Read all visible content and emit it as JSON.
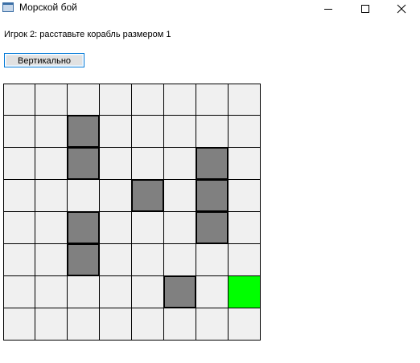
{
  "window": {
    "title": "Морской бой",
    "icon": "app-window-icon",
    "controls": {
      "minimize": "minimize-icon",
      "maximize": "maximize-icon",
      "close": "close-icon"
    }
  },
  "status": {
    "prompt": "Игрок 2: расставьте корабль размером 1"
  },
  "toolbar": {
    "orientation_label": "Вертикально"
  },
  "board": {
    "rows": 8,
    "cols": 8,
    "colors": {
      "empty": "#f0f0f0",
      "ship": "#808080",
      "preview": "#00ff00",
      "grid": "#000000"
    },
    "cells": [
      [
        "empty",
        "empty",
        "empty",
        "empty",
        "empty",
        "empty",
        "empty",
        "empty"
      ],
      [
        "empty",
        "empty",
        "ship",
        "empty",
        "empty",
        "empty",
        "empty",
        "empty"
      ],
      [
        "empty",
        "empty",
        "ship",
        "empty",
        "empty",
        "empty",
        "ship",
        "empty"
      ],
      [
        "empty",
        "empty",
        "empty",
        "empty",
        "ship",
        "empty",
        "ship",
        "empty"
      ],
      [
        "empty",
        "empty",
        "ship",
        "empty",
        "empty",
        "empty",
        "ship",
        "empty"
      ],
      [
        "empty",
        "empty",
        "ship",
        "empty",
        "empty",
        "empty",
        "empty",
        "empty"
      ],
      [
        "empty",
        "empty",
        "empty",
        "empty",
        "empty",
        "ship",
        "empty",
        "preview"
      ],
      [
        "empty",
        "empty",
        "empty",
        "empty",
        "empty",
        "empty",
        "empty",
        "empty"
      ]
    ]
  }
}
